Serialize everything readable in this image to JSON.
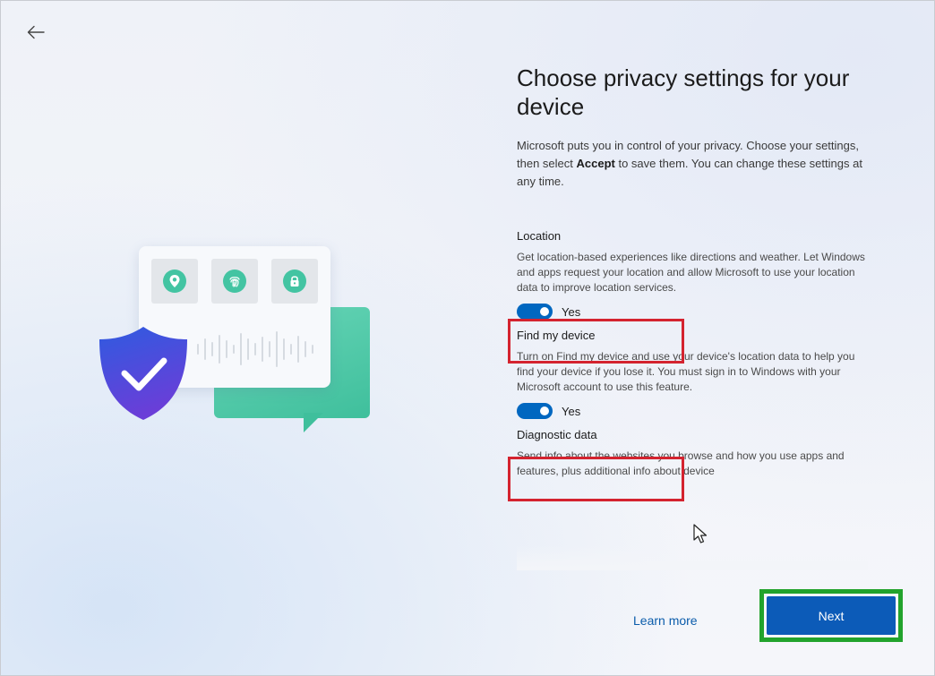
{
  "header": {
    "back_icon": "arrow-left-icon"
  },
  "page": {
    "title": "Choose privacy settings for your device",
    "intro_before": "Microsoft puts you in control of your privacy. Choose your settings, then select ",
    "intro_bold": "Accept",
    "intro_after": " to save them. You can change these settings at any time."
  },
  "illustration": {
    "icons": [
      "location-pin-icon",
      "fingerprint-icon",
      "lock-icon",
      "shield-check-icon",
      "audio-wave-icon",
      "chat-bubble-icon"
    ],
    "colors": {
      "teal": "#43c4a2",
      "shield_top": "#2f5be0",
      "shield_bottom": "#6a3ed8"
    }
  },
  "settings": [
    {
      "title": "Location",
      "description": "Get location-based experiences like directions and weather. Let Windows and apps request your location and allow Microsoft to use your location data to improve location services.",
      "toggle_state": "on",
      "toggle_label": "Yes"
    },
    {
      "title": "Find my device",
      "description": "Turn on Find my device and use your device's location data to help you find your device if you lose it. You must sign in to Windows with your Microsoft account to use this feature.",
      "toggle_state": "on",
      "toggle_label": "Yes"
    },
    {
      "title": "Diagnostic data",
      "description": "Send info about the websites you browse and how you use apps and features, plus additional info about device"
    }
  ],
  "footer": {
    "learn_more": "Learn more",
    "next": "Next"
  },
  "colors": {
    "accent": "#0067c0",
    "button": "#0c5bb8",
    "highlight_red": "#d4232f",
    "highlight_green": "#22a32c"
  }
}
